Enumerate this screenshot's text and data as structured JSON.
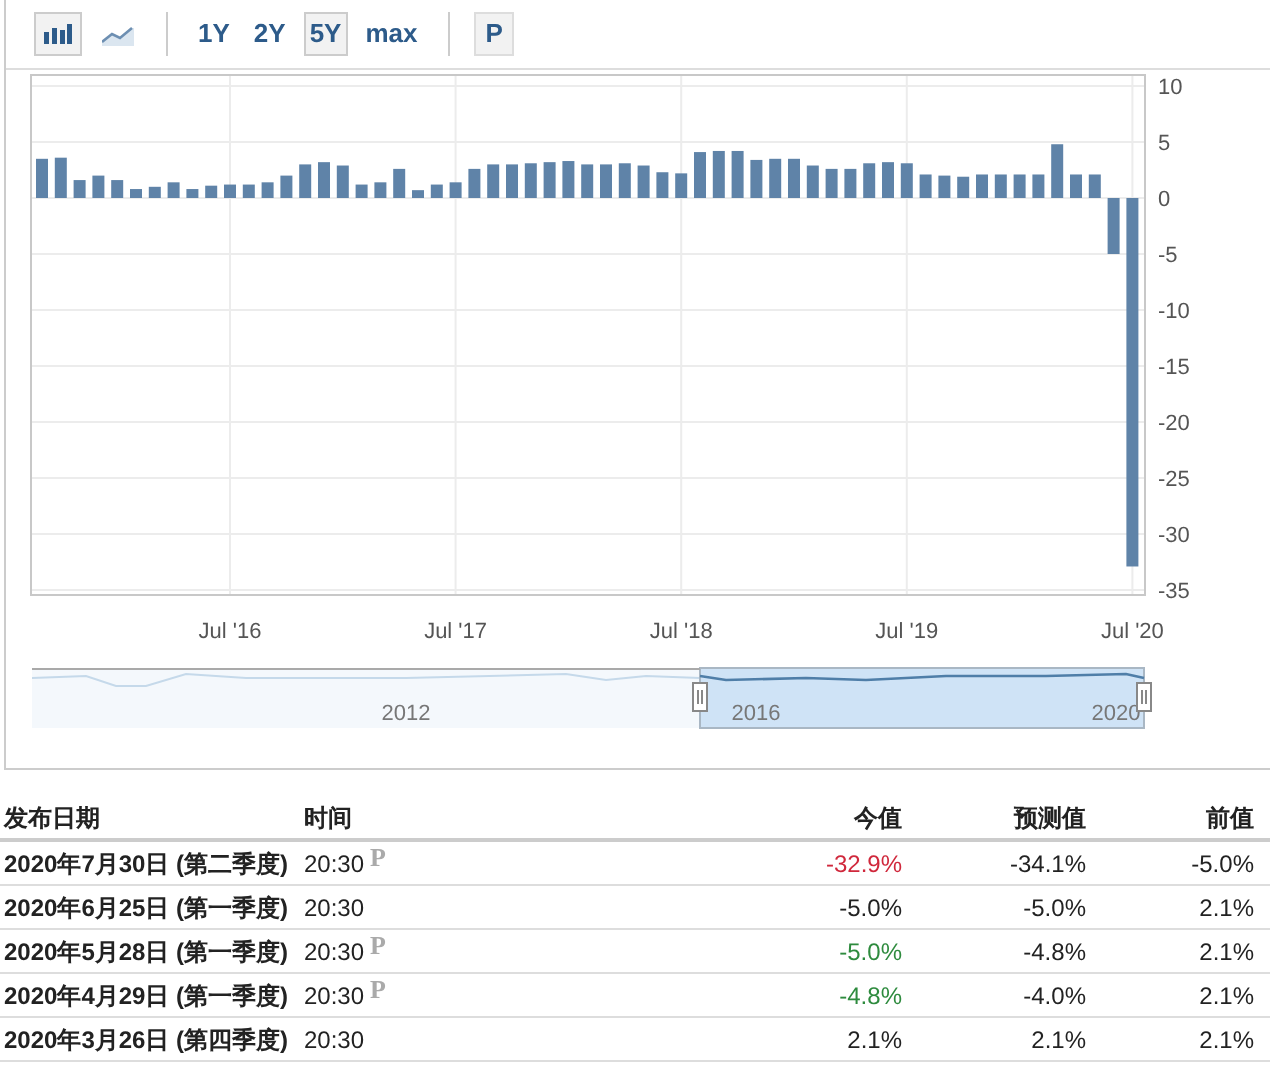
{
  "toolbar": {
    "chart_types": [
      {
        "kind": "bar",
        "selected": true
      },
      {
        "kind": "area",
        "selected": false
      }
    ],
    "ranges": [
      {
        "label": "1Y",
        "selected": false
      },
      {
        "label": "2Y",
        "selected": false
      },
      {
        "label": "5Y",
        "selected": true
      },
      {
        "label": "max",
        "selected": false
      }
    ],
    "preliminary_button": "P"
  },
  "chart": {
    "chart_data": {
      "type": "bar",
      "categories": [
        null,
        null,
        null,
        null,
        null,
        null,
        null,
        null,
        null,
        null,
        "Jul '16",
        null,
        null,
        null,
        null,
        null,
        null,
        null,
        null,
        null,
        null,
        null,
        "Jul '17",
        null,
        null,
        null,
        null,
        null,
        null,
        null,
        null,
        null,
        null,
        null,
        "Jul '18",
        null,
        null,
        null,
        null,
        null,
        null,
        null,
        null,
        null,
        null,
        null,
        "Jul '19",
        null,
        null,
        null,
        null,
        null,
        null,
        null,
        null,
        null,
        null,
        null,
        "Jul '20"
      ],
      "values": [
        3.5,
        3.6,
        1.6,
        2.0,
        1.6,
        0.8,
        1.0,
        1.4,
        0.8,
        1.1,
        1.2,
        1.2,
        1.4,
        2.0,
        3.0,
        3.2,
        2.9,
        1.2,
        1.4,
        2.6,
        0.7,
        1.2,
        1.4,
        2.6,
        3.0,
        3.0,
        3.1,
        3.2,
        3.3,
        3.0,
        3.0,
        3.1,
        2.9,
        2.3,
        2.2,
        4.1,
        4.2,
        4.2,
        3.4,
        3.5,
        3.5,
        2.9,
        2.6,
        2.6,
        3.1,
        3.2,
        3.1,
        2.1,
        2.0,
        1.9,
        2.1,
        2.1,
        2.1,
        2.1,
        4.8,
        2.1,
        2.1,
        -5.0,
        -32.9
      ],
      "grid": true,
      "ylim": [
        -35,
        10
      ],
      "yticks": [
        10,
        5,
        0,
        -5,
        -10,
        -15,
        -20,
        -25,
        -30,
        -35
      ]
    }
  },
  "navigator": {
    "years": [
      "2012",
      "2016",
      "2020"
    ]
  },
  "table": {
    "columns": [
      "发布日期",
      "时间",
      "今值",
      "预测值",
      "前值"
    ],
    "rows": [
      {
        "date": "2020年7月30日 (第二季度)",
        "time": "20:30",
        "mark": "P",
        "actual": "-32.9%",
        "color": "#d0283c",
        "forecast": "-34.1%",
        "previous": "-5.0%"
      },
      {
        "date": "2020年6月25日 (第一季度)",
        "time": "20:30",
        "actual": "-5.0%",
        "color": "#222222",
        "forecast": "-5.0%",
        "previous": "2.1%"
      },
      {
        "date": "2020年5月28日 (第一季度)",
        "time": "20:30",
        "mark": "P",
        "actual": "-5.0%",
        "color": "#2e8b3e",
        "forecast": "-4.8%",
        "previous": "2.1%"
      },
      {
        "date": "2020年4月29日 (第一季度)",
        "time": "20:30",
        "mark": "P",
        "actual": "-4.8%",
        "color": "#2e8b3e",
        "forecast": "-4.0%",
        "previous": "2.1%"
      },
      {
        "date": "2020年3月26日 (第四季度)",
        "time": "20:30",
        "actual": "2.1%",
        "color": "#222222",
        "forecast": "2.1%",
        "previous": "2.1%"
      }
    ]
  }
}
